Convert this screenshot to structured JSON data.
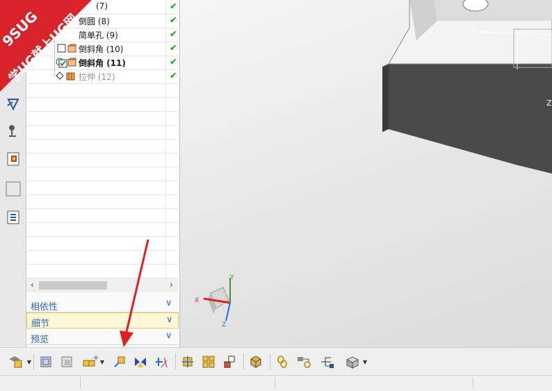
{
  "watermark": {
    "line1": "9SUG",
    "line2": "学UG就上UG网"
  },
  "tree": {
    "rows": [
      {
        "label": "(7)",
        "bold": false,
        "grey": false,
        "check": "✔"
      },
      {
        "label": "倒圆 (8)",
        "bold": false,
        "grey": false,
        "check": "✔"
      },
      {
        "label": "简单孔 (9)",
        "bold": false,
        "grey": false,
        "check": "✔"
      },
      {
        "label": "倒斜角 (10)",
        "bold": false,
        "grey": false,
        "check": "✔"
      },
      {
        "label": "倒斜角 (11)",
        "bold": true,
        "grey": false,
        "check": "✔"
      },
      {
        "label": "拉伸 (12)",
        "bold": false,
        "grey": true,
        "check": "✔"
      }
    ]
  },
  "scroll": {
    "left": "‹",
    "right": "›"
  },
  "sections": [
    {
      "title": "相依性",
      "chev": "∨"
    },
    {
      "title": "细节",
      "chev": "∨"
    },
    {
      "title": "预览",
      "chev": "∨"
    }
  ],
  "viewport": {
    "csys_x": "X",
    "csys_z": "Z",
    "triad_x": "X",
    "triad_y": "Y",
    "triad_z": "Z"
  },
  "colors": {
    "body_dark": "#4a4a4a",
    "body_light": "#f4f4f4",
    "section_title": "#2d67b8",
    "check": "#1aa01a",
    "arrow": "#e02020"
  },
  "icons": {
    "toolbar": [
      "edit-feature-icon",
      "replay-icon",
      "suppress-icon",
      "unsuppress-icon",
      "insert-feature-icon",
      "mirror-icon",
      "trim-icon",
      "move-face-icon",
      "group-icon",
      "pattern-icon",
      "update-icon",
      "link-icon",
      "wave-link-icon",
      "assembly-tree-icon",
      "view-cube-icon"
    ]
  }
}
